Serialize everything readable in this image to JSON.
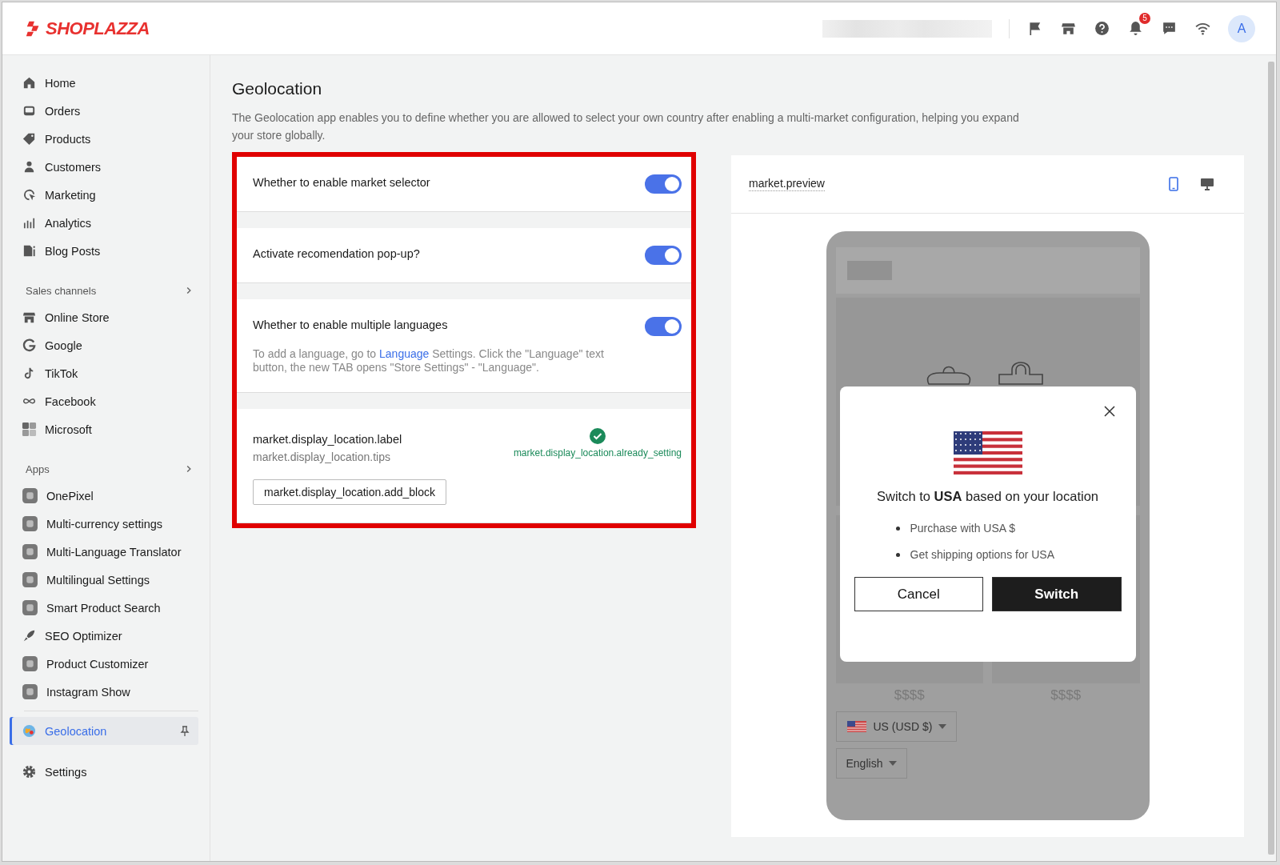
{
  "header": {
    "logo": "SHOPLAZZA",
    "notification_count": "5",
    "avatar": "A"
  },
  "sidebar": {
    "groups": [
      {
        "items": [
          {
            "label": "Home",
            "selected": false
          },
          {
            "label": "Orders",
            "selected": false
          },
          {
            "label": "Products",
            "selected": false
          },
          {
            "label": "Customers",
            "selected": false
          },
          {
            "label": "Marketing",
            "selected": false
          },
          {
            "label": "Analytics",
            "selected": false
          },
          {
            "label": "Blog Posts",
            "selected": false
          }
        ]
      },
      {
        "title": "Sales channels",
        "items": [
          {
            "label": "Online Store",
            "selected": false
          },
          {
            "label": "Google",
            "selected": false
          },
          {
            "label": "TikTok",
            "selected": false
          },
          {
            "label": "Facebook",
            "selected": false
          },
          {
            "label": "Microsoft",
            "selected": false
          }
        ]
      },
      {
        "title": "Apps",
        "items": [
          {
            "label": "OnePixel",
            "selected": false
          },
          {
            "label": "Multi-currency settings",
            "selected": false
          },
          {
            "label": "Multi-Language Translator",
            "selected": false
          },
          {
            "label": "Multilingual Settings",
            "selected": false
          },
          {
            "label": "Smart Product Search",
            "selected": false
          },
          {
            "label": "SEO Optimizer",
            "selected": false
          },
          {
            "label": "Product Customizer",
            "selected": false
          },
          {
            "label": "Instagram Show",
            "selected": false
          }
        ]
      },
      {
        "items": [
          {
            "label": "Geolocation",
            "selected": true
          }
        ]
      },
      {
        "items": [
          {
            "label": "Settings",
            "selected": false
          }
        ]
      }
    ]
  },
  "page": {
    "title": "Geolocation",
    "description": "The Geolocation app enables you to define whether you are allowed to select your own country after enabling a multi-market configuration, helping you expand your store globally."
  },
  "settings": [
    {
      "kind": "toggle",
      "label": "Whether to enable market selector",
      "on": true
    },
    {
      "kind": "toggle",
      "label": "Activate recomendation pop-up?",
      "on": true
    },
    {
      "kind": "toggle",
      "label": "Whether to enable multiple languages",
      "on": true,
      "help_before": "To add a language, go to ",
      "help_link": "Language",
      "help_after": " Settings. Click the \"Language\" text button, the new TAB opens \"Store Settings\" - \"Language\"."
    },
    {
      "kind": "block",
      "label": "market.display_location.label",
      "tips": "market.display_location.tips",
      "status": "market.display_location.already_setting",
      "button": "market.display_location.add_block"
    }
  ],
  "preview": {
    "title": "market.preview",
    "devices": [
      {
        "selected": true
      },
      {
        "selected": false
      }
    ],
    "prices": [
      "$$$$",
      "$$$$"
    ],
    "currency_selector": "US (USD $)",
    "language_selector": "English",
    "popup": {
      "title": "Switch to **USA** based on your location",
      "bullets": [
        "Purchase with USA $",
        "Get shipping options for USA"
      ],
      "cancel": "Cancel",
      "confirm": "Switch"
    }
  }
}
